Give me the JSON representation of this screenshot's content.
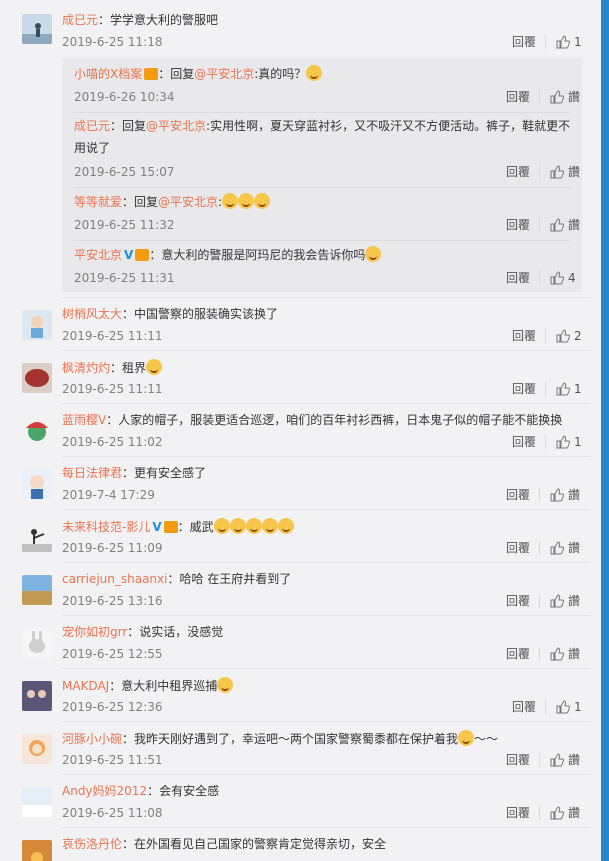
{
  "ui": {
    "reply_label": "回覆",
    "like_label": "讚"
  },
  "comments": [
    {
      "user": "成已元",
      "text": "：学学意大利的警服吧",
      "time": "2019-6-25 11:18",
      "likes": "1",
      "avatar_icon": "person-on-hill-avatar",
      "sub_replies": [
        {
          "user": "小喵的X档案",
          "has_badge": true,
          "prefix": "：回复",
          "mention": "@平安北京",
          "text": ":真的吗？",
          "emoji": "thinking",
          "time": "2019-6-26 10:34",
          "likes": "讚"
        },
        {
          "user": "成已元",
          "prefix": "：回复",
          "mention": "@平安北京",
          "text": ":实用性啊，夏天穿蓝衬衫，又不吸汗又不方便活动。裤子，鞋就更不",
          "text2": "用说了",
          "time": "2019-6-25 15:07",
          "likes": "讚"
        },
        {
          "user": "等等就爱",
          "prefix": "：回复",
          "mention": "@平安北京",
          "text": ":",
          "emoji": "laugh-cry ×3",
          "time": "2019-6-25 11:32",
          "likes": "讚"
        },
        {
          "user": "平安北京",
          "verified": true,
          "has_badge": true,
          "prefix": "",
          "mention": "",
          "text": "：意大利的警服是阿玛尼的我会告诉你吗",
          "emoji": "smile",
          "time": "2019-6-25 11:31",
          "likes": "4"
        }
      ]
    },
    {
      "user": "树梢风太大",
      "text": "：中国警察的服装确实该换了",
      "time": "2019-6-25 11:11",
      "likes": "2",
      "avatar_icon": "anime-avatar"
    },
    {
      "user": "枫清灼灼",
      "text": "：租界",
      "emoji": "doge",
      "time": "2019-6-25 11:11",
      "likes": "1",
      "avatar_icon": "red-cookie-avatar"
    },
    {
      "user": "蓝雨樱V",
      "text": "：人家的帽子，服装更适合巡逻，咱们的百年衬衫西裤，日本鬼子似的帽子能不能换换",
      "time": "2019-6-25 11:02",
      "likes": "1",
      "avatar_icon": "cartoon-monster-avatar"
    },
    {
      "user": "每日法律君",
      "text": "：更有安全感了",
      "time": "2019-7-4 17:29",
      "likes": "讚",
      "avatar_icon": "police-girl-avatar"
    },
    {
      "user": "未来科技范-影儿",
      "verified": true,
      "has_badge": true,
      "text": "：威武",
      "emoji": "applause ×5",
      "time": "2019-6-25 11:09",
      "likes": "讚",
      "avatar_icon": "pose-avatar"
    },
    {
      "user": "carriejun_shaanxi",
      "text": "：哈哈 在王府井看到了",
      "time": "2019-6-25 13:16",
      "likes": "讚",
      "avatar_icon": "landscape-avatar"
    },
    {
      "user": "宠你如初grr",
      "text": "：说实话，没感觉",
      "time": "2019-6-25 12:55",
      "likes": "讚",
      "avatar_icon": "bunny-avatar"
    },
    {
      "user": "MAKDAJ",
      "text": "：意大利中租界巡捕",
      "emoji": "doge",
      "time": "2019-6-25 12:36",
      "likes": "1",
      "avatar_icon": "group-photo-avatar"
    },
    {
      "user": "河豚小小碗",
      "text": "：我昨天刚好遇到了，幸运吧～两个国家警察蜀黍都在保护着我",
      "emoji": "shy",
      "text_after": "～～",
      "time": "2019-6-25 11:51",
      "likes": "讚",
      "avatar_icon": "anime-girl-avatar"
    },
    {
      "user": "Andy妈妈2012",
      "text": "：会有安全感",
      "time": "2019-6-25 11:08",
      "likes": "讚",
      "avatar_icon": "snow-avatar"
    },
    {
      "user": "哀伤洛丹伦",
      "text": "：在外国看见自己国家的警察肯定觉得亲切，安全",
      "time": "",
      "likes": "",
      "avatar_icon": "sunset-avatar"
    }
  ]
}
